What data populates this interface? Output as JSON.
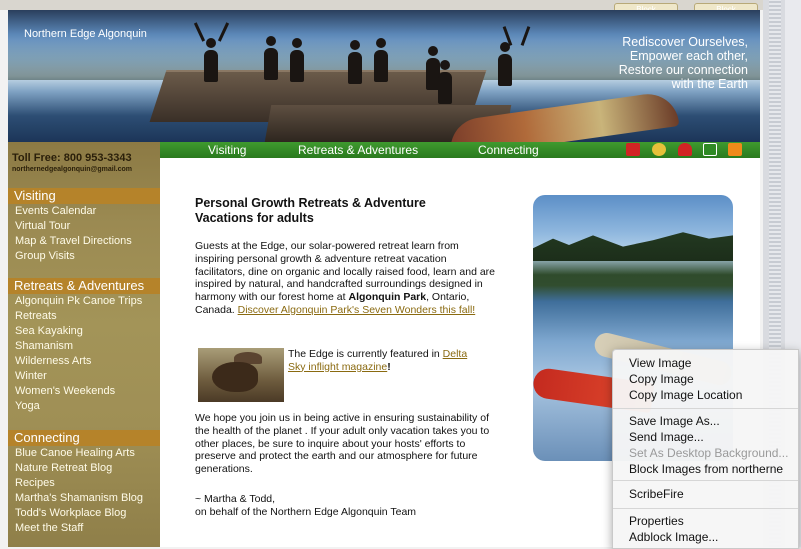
{
  "header": {
    "brand": "Northern Edge Algonquin",
    "tagline": [
      "Rediscover Ourselves,",
      "Empower each other,",
      "Restore our connection",
      "with the Earth"
    ],
    "block_tabs": [
      "Block",
      "Block"
    ]
  },
  "sidebar": {
    "toll_free": "Toll Free: 800 953-3343",
    "email": "northernedgealgonquin@gmail.com",
    "sections": [
      {
        "title": "Visiting",
        "items": [
          "Events Calendar",
          "Virtual Tour",
          "Map & Travel Directions",
          "Group Visits"
        ]
      },
      {
        "title": "Retreats & Adventures",
        "items": [
          "Algonquin Pk Canoe Trips",
          "Retreats",
          "Sea Kayaking",
          "Shamanism",
          "Wilderness Arts",
          "Winter",
          "Women's Weekends",
          "Yoga"
        ]
      },
      {
        "title": "Connecting",
        "items": [
          "Blue Canoe Healing Arts",
          "Nature Retreat Blog",
          "Recipes",
          "Martha's Shamanism Blog",
          "Todd's Workplace Blog",
          "Meet the Staff"
        ]
      }
    ]
  },
  "nav": {
    "links": [
      "Visiting",
      "Retreats & Adventures",
      "Connecting"
    ],
    "icons": [
      "canada-flag-icon",
      "people-icon",
      "home-icon",
      "email-icon",
      "rss-icon"
    ]
  },
  "content": {
    "heading": "Personal Growth Retreats & Adventure Vacations for adults",
    "intro_text": "Guests at the Edge, our solar-powered retreat learn from inspiring personal growth & adventure retreat vacation facilitators, dine on organic and locally raised food, learn and are inspired by natural, and handcrafted surroundings designed in harmony with our forest home at",
    "intro_bold": "Algonquin Park",
    "intro_after": ", Ontario, Canada.",
    "intro_link": "Discover Algonquin Park's Seven Wonders this fall!",
    "featured_text": "The Edge is currently featured in",
    "featured_link": "Delta Sky inflight magazine",
    "featured_end": "!",
    "para2": "We hope you join us in being active in ensuring sustainability of the health of the planet . If your adult only vacation takes you to other places, be sure to inquire about your hosts' efforts to preserve and protect the earth and our atmosphere for future generations.",
    "sign1": "~ Martha & Todd,",
    "sign2": "on behalf of the Northern Edge Algonquin Team"
  },
  "context_menu": {
    "items": [
      {
        "label": "View Image",
        "disabled": false
      },
      {
        "label": "Copy Image",
        "disabled": false
      },
      {
        "label": "Copy Image Location",
        "disabled": false
      },
      {
        "label": "Save Image As...",
        "disabled": false
      },
      {
        "label": "Send Image...",
        "disabled": false
      },
      {
        "label": "Set As Desktop Background...",
        "disabled": true
      },
      {
        "label": "Block Images from northerne",
        "disabled": false
      },
      {
        "label": "ScribeFire",
        "disabled": false
      },
      {
        "label": "Properties",
        "disabled": false
      },
      {
        "label": "Adblock Image...",
        "disabled": false
      }
    ]
  },
  "colors": {
    "nav_green": "#2f8a24",
    "section_orange": "#b5832a",
    "link_gold": "#8a6a10"
  }
}
